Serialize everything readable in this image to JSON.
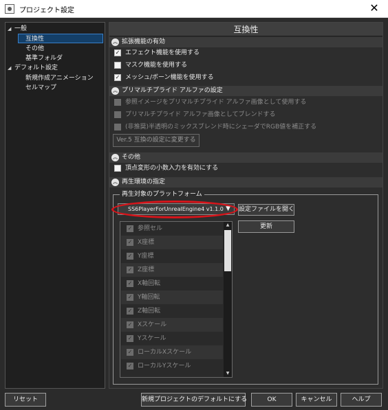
{
  "window": {
    "title": "プロジェクト設定",
    "close_glyph": "✕"
  },
  "tree": [
    {
      "label": "一般",
      "arrow": "◢"
    },
    {
      "label": "互換性",
      "selected": true
    },
    {
      "label": "その他"
    },
    {
      "label": "基準フォルダ"
    },
    {
      "label": "デフォルト設定",
      "arrow": "◢"
    },
    {
      "label": "新規作成アニメーション"
    },
    {
      "label": "セルマップ"
    }
  ],
  "page": {
    "title": "互換性"
  },
  "sections": {
    "extended": {
      "label": "拡張機能の有効",
      "chevron": "︽"
    },
    "premultiplied": {
      "label": "プリマルチプライド アルファの設定",
      "chevron": "︽"
    },
    "other": {
      "label": "その他",
      "chevron": "︽"
    },
    "playback": {
      "label": "再生環境の指定",
      "chevron": "︽"
    }
  },
  "options": {
    "effect": {
      "label": "エフェクト機能を使用する",
      "checked": true
    },
    "mask": {
      "label": "マスク機能を使用する",
      "checked": false
    },
    "mesh": {
      "label": "メッシュ/ボーン機能を使用する",
      "checked": true
    },
    "ref_image": {
      "label": "参照イメージをプリマルチプライド アルファ画像として使用する",
      "checked": false,
      "disabled": true
    },
    "blend": {
      "label": "プリマルチプライド アルファ画像としてブレンドする",
      "checked": false,
      "disabled": true
    },
    "rgb_fix": {
      "label": "(非推奨)半透明のミックスブレンド時にシェーダでRGB値を補正する",
      "checked": false,
      "disabled": true
    },
    "vertex_decimal": {
      "label": "頂点変形の小数入力を有効にする",
      "checked": false
    }
  },
  "buttons": {
    "ver5": "Ver.5 互換の設定に変更する",
    "open_settings_file": "設定ファイルを開く",
    "refresh": "更新"
  },
  "platform": {
    "group_title": "再生対象のプラットフォーム",
    "selected": "SS6PlayerForUnrealEngine4 v1.1.0",
    "caret": "▼"
  },
  "attributes": [
    {
      "label": "参照セル",
      "checked": true
    },
    {
      "label": "X座標",
      "checked": true
    },
    {
      "label": "Y座標",
      "checked": true
    },
    {
      "label": "Z座標",
      "checked": true
    },
    {
      "label": "X軸回転",
      "checked": true
    },
    {
      "label": "Y軸回転",
      "checked": true
    },
    {
      "label": "Z軸回転",
      "checked": true
    },
    {
      "label": "Xスケール",
      "checked": true
    },
    {
      "label": "Yスケール",
      "checked": true
    },
    {
      "label": "ローカルXスケール",
      "checked": true
    },
    {
      "label": "ローカルYスケール",
      "checked": true
    }
  ],
  "scrollbar": {
    "up": "▲",
    "down": "▼"
  },
  "footer": {
    "reset": "リセット",
    "default_for_new": "新規プロジェクトのデフォルトにする",
    "ok": "OK",
    "cancel": "キャンセル",
    "help": "ヘルプ"
  },
  "check_glyph": "✓",
  "colors": {
    "selection": "#143f68",
    "highlight_ring": "#d7141a"
  }
}
